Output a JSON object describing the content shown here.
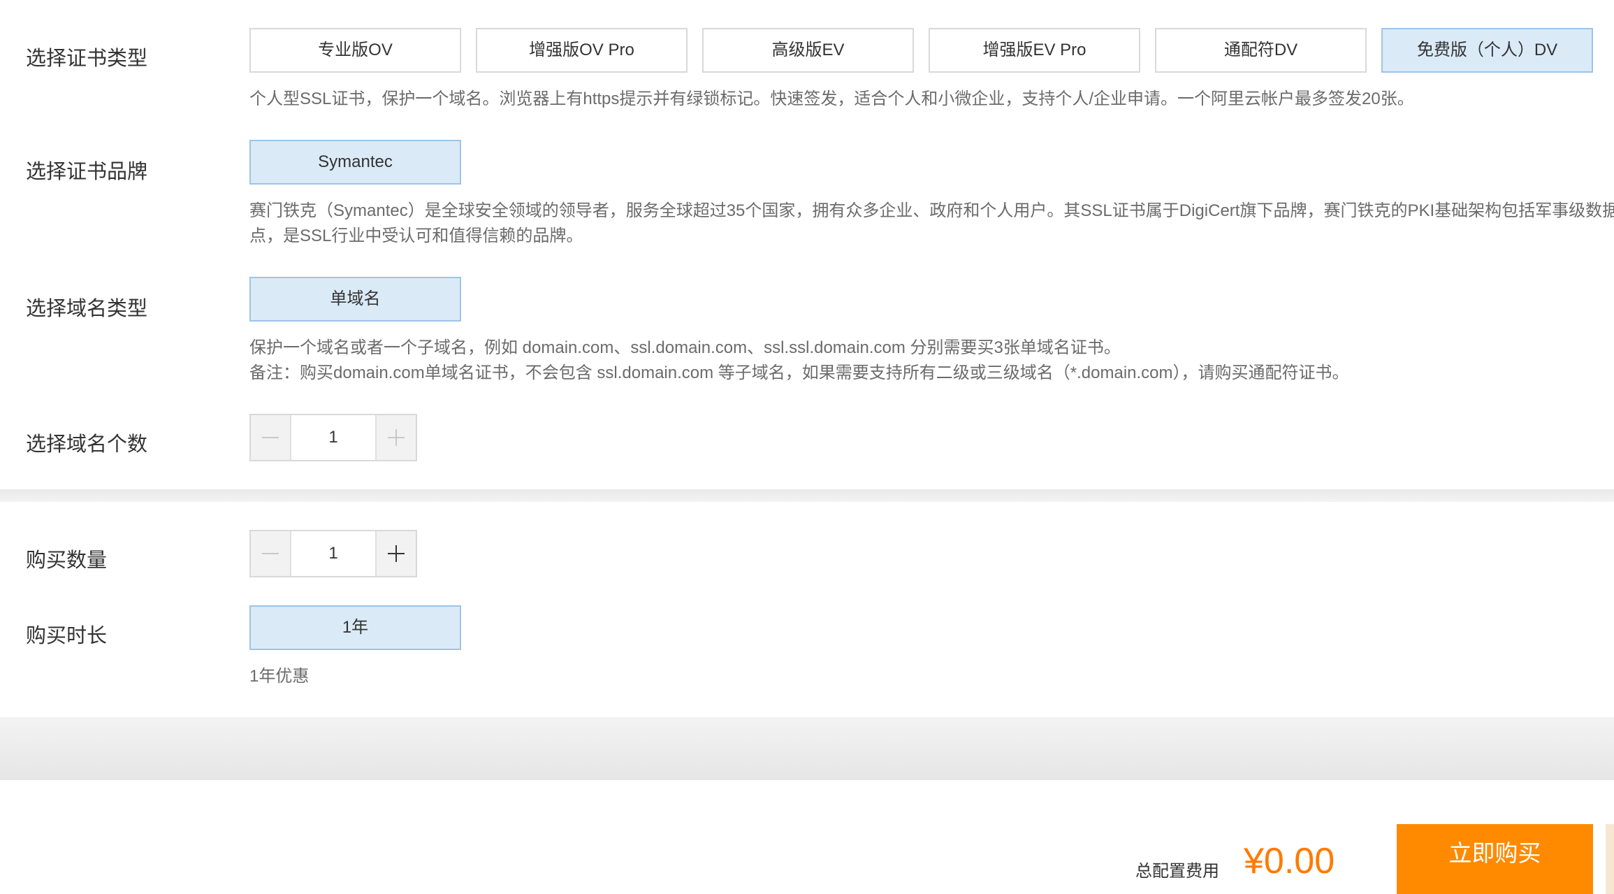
{
  "cert_type": {
    "label": "选择证书类型",
    "options": [
      "专业版OV",
      "增强版OV Pro",
      "高级版EV",
      "增强版EV Pro",
      "通配符DV",
      "免费版（个人）DV"
    ],
    "selected": "免费版（个人）DV",
    "description": "个人型SSL证书，保护一个域名。浏览器上有https提示并有绿锁标记。快速签发，适合个人和小微企业，支持个人/企业申请。一个阿里云帐户最多签发20张。"
  },
  "cert_brand": {
    "label": "选择证书品牌",
    "option": "Symantec",
    "description_line1": "赛门铁克（Symantec）是全球安全领域的领导者，服务全球超过35个国家，拥有众多企业、政府和个人用户。其SSL证书属于DigiCert旗下品牌，赛门铁克的PKI基础架构包括军事级数据中",
    "description_line2": "点，是SSL行业中受认可和值得信赖的品牌。"
  },
  "domain_type": {
    "label": "选择域名类型",
    "option": "单域名",
    "description_line1": "保护一个域名或者一个子域名，例如 domain.com、ssl.domain.com、ssl.ssl.domain.com 分别需要买3张单域名证书。",
    "description_line2": "备注：购买domain.com单域名证书，不会包含 ssl.domain.com 等子域名，如果需要支持所有二级或三级域名（*.domain.com），请购买通配符证书。"
  },
  "domain_count": {
    "label": "选择域名个数",
    "value": "1",
    "minus_enabled": false,
    "plus_enabled": false
  },
  "purchase_quantity": {
    "label": "购买数量",
    "value": "1",
    "minus_enabled": false,
    "plus_enabled": true
  },
  "purchase_duration": {
    "label": "购买时长",
    "option": "1年",
    "note": "1年优惠"
  },
  "footer": {
    "total_label": "总配置费用",
    "price": "¥0.00",
    "buy_button": "立即购买"
  },
  "colors": {
    "selected_bg": "#dbeaf7",
    "selected_border": "#9cc5ea",
    "accent_orange": "#ff8a00",
    "price_orange": "#ff7a00"
  }
}
